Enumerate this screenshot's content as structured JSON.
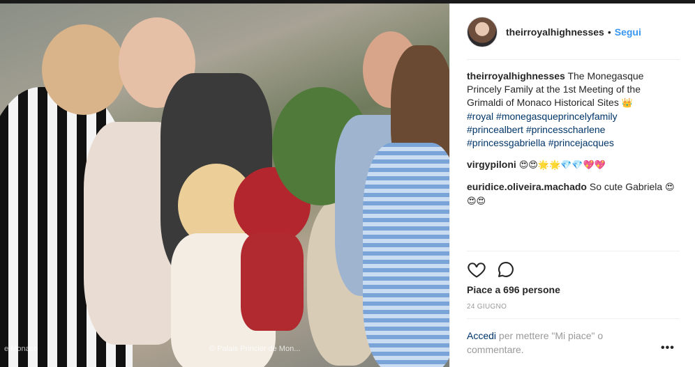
{
  "post": {
    "photo_credit_left": "e Monaco",
    "photo_credit": "© Palais Princier de Mon..."
  },
  "header": {
    "username": "theirroyalhighnesses",
    "separator": "•",
    "follow_label": "Segui"
  },
  "caption": {
    "username": "theirroyalhighnesses",
    "text": "The Monegasque Princely Family at the 1st Meeting of the Grimaldi of Monaco Historical Sites",
    "emoji": "👑",
    "hashtags": [
      "#royal",
      "#monegasqueprincelyfamily",
      "#princealbert",
      "#princesscharlene",
      "#princessgabriella",
      "#princejacques"
    ]
  },
  "comments": [
    {
      "username": "virgypiloni",
      "text": "",
      "emoji": "😍😍🌟🌟💎💎💖💖"
    },
    {
      "username": "euridice.oliveira.machado",
      "text": "So cute Gabriela",
      "emoji": "😍😍😍"
    }
  ],
  "actions": {
    "like_icon": "heart-icon",
    "comment_icon": "comment-bubble-icon"
  },
  "likes_label": "Piace a 696 persone",
  "date_label": "24 GIUGNO",
  "login": {
    "link": "Accedi",
    "text": "per mettere \"Mi piace\" o commentare."
  },
  "more_label": "•••",
  "colors": {
    "follow": "#3897f0",
    "hashtag": "#003569",
    "muted": "#999999"
  }
}
